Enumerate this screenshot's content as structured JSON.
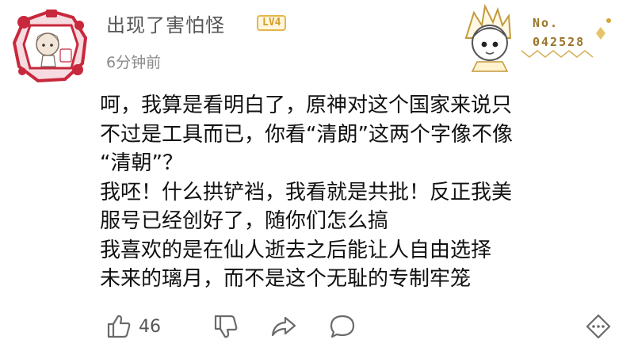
{
  "comment": {
    "username": "出现了害怕怪",
    "level_badge": "LV4",
    "timestamp": "6分钟前",
    "lines": [
      "呵，我算是看明白了，原神对这个国家来说只",
      "不过是工具而已，你看“清朗”这两个字像不像",
      "“清朝”？",
      "我呸！什么拱铲裆，我看就是共批！反正我美",
      "服号已经创好了，随你们怎么搞",
      "我喜欢的是在仙人逝去之后能让人自由选择",
      "未来的璃月，而不是这个无耻的专制牢笼"
    ]
  },
  "fan_card": {
    "label": "No.",
    "number": "042528"
  },
  "actions": {
    "like_count": "46",
    "icons": [
      "thumbs-up-icon",
      "thumbs-down-icon",
      "share-icon",
      "comment-icon",
      "more-icon"
    ]
  },
  "colors": {
    "username": "#555555",
    "badge": "#e4b64b",
    "avatar_frame": "#c8283c",
    "icon": "#6a6a6a"
  }
}
